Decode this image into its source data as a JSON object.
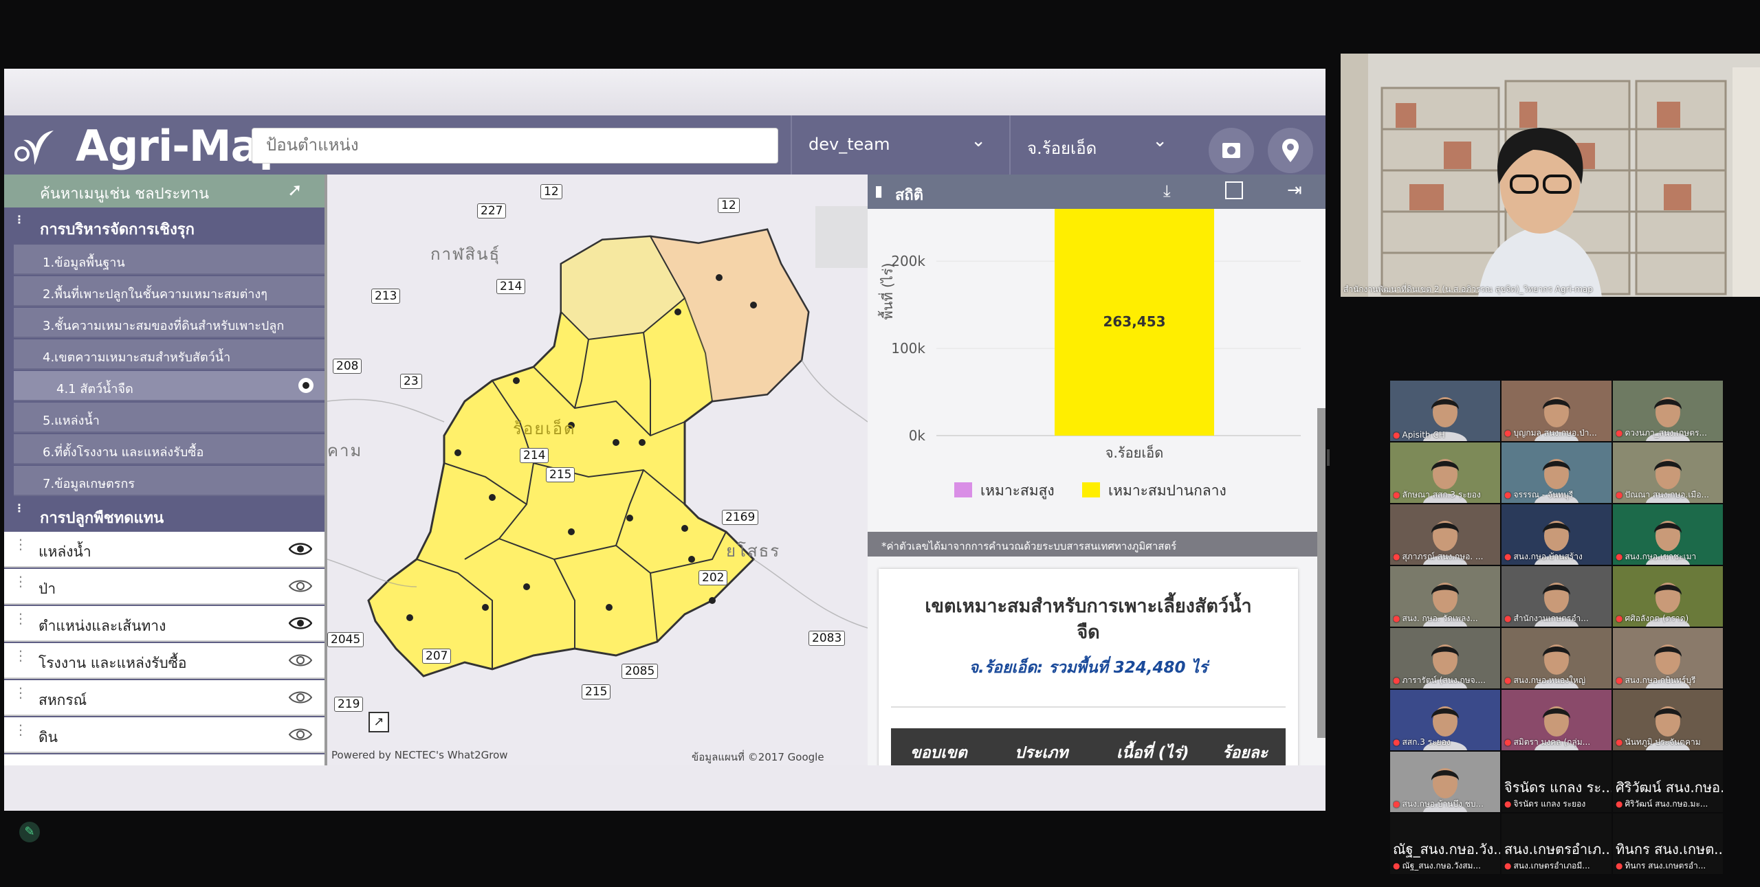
{
  "app": {
    "brand": "Agri-Map",
    "search_placeholder": "ป้อนตำแหน่ง",
    "team_select": "dev_team",
    "province_select": "จ.ร้อยเอ็ด"
  },
  "sidebar": {
    "menu_search_placeholder": "ค้นหาเมนูเช่น ชลประทาน",
    "section1_title": "การบริหารจัดการเชิงรุก",
    "items": [
      {
        "label": "1.ข้อมูลพื้นฐาน"
      },
      {
        "label": "2.พื้นที่เพาะปลูกในชั้นความเหมาะสมต่างๆ"
      },
      {
        "label": "3.ชั้นความเหมาะสมของที่ดินสำหรับเพาะปลูก"
      },
      {
        "label": "4.เขตความเหมาะสมสำหรับสัตว์น้ำ"
      },
      {
        "label": "4.1 สัตว์น้ำจืด"
      },
      {
        "label": "5.แหล่งน้ำ"
      },
      {
        "label": "6.ที่ตั้งโรงงาน และแหล่งรับซื้อ"
      },
      {
        "label": "7.ข้อมูลเกษตรกร"
      }
    ],
    "section2_title": "การปลูกพืชทดแทน",
    "layers": [
      {
        "label": "แหล่งน้ำ"
      },
      {
        "label": "ป่า"
      },
      {
        "label": "ตำแหน่งและเส้นทาง"
      },
      {
        "label": "โรงงาน และแหล่งรับซื้อ"
      },
      {
        "label": "สหกรณ์"
      },
      {
        "label": "ดิน"
      }
    ]
  },
  "map": {
    "places": [
      "กาฬสินธุ์",
      "ร้อยเอ็ด",
      "ยโสธร",
      "คาม"
    ],
    "roads": [
      "12",
      "227",
      "12",
      "213",
      "214",
      "208",
      "23",
      "214",
      "215",
      "2169",
      "202",
      "2045",
      "207",
      "2085",
      "219",
      "215",
      "2083"
    ],
    "attribution_left": "Powered by NECTEC's What2Grow",
    "attribution_right": "ข้อมูลแผนที่ ©2017 Google"
  },
  "stats": {
    "title": "สถิติ",
    "note": "*ค่าตัวเลขได้มาจากการคำนวณด้วยระบบสารสนเทศทางภูมิศาสตร์",
    "card_title_line1": "เขตเหมาะสมสำหรับการเพาะเลี้ยงสัตว์น้ำ",
    "card_title_line2": "จืด",
    "card_subtitle": "จ.ร้อยเอ็ด: รวมพื้นที่ 324,480 ไร่",
    "table_headers": [
      "ขอบเขต",
      "ประเภท",
      "เนื้อที่ (ไร่)",
      "ร้อยละ"
    ]
  },
  "chart_data": {
    "type": "bar",
    "categories": [
      "จ.ร้อยเอ็ด"
    ],
    "series": [
      {
        "name": "เหมาะสมสูง",
        "values": [
          0
        ],
        "color": "#d98ee6"
      },
      {
        "name": "เหมาะสมปานกลาง",
        "values": [
          263453
        ],
        "color": "#ffee00"
      }
    ],
    "data_labels": [
      "263,453"
    ],
    "ylabel": "พื้นที่ (ไร่)",
    "yticks": [
      "0k",
      "100k",
      "200k"
    ],
    "ylim": [
      0,
      260000
    ],
    "legend": "bottom"
  },
  "meeting": {
    "speaker_name": "สำนักงานพัฒนาที่ดินเขต 2 (น.ส.อภิวรรณ สุขจิต)_วิทยากร Agri-map",
    "participants": [
      {
        "name": "Apisith CH"
      },
      {
        "name": "บุญกมล สนง.กษอ.ป่า..."
      },
      {
        "name": "ดวงนภา_สนง.เกษตร..."
      },
      {
        "name": "ลักษณา สสก.3 ระยอง"
      },
      {
        "name": "จรรรณ - จันทบุรี"
      },
      {
        "name": "ปัณณา สนง.กษอ.เมือ..."
      },
      {
        "name": "สุภาภรณ์ สนง.กษอ. ..."
      },
      {
        "name": "สนง.กษอ.บ้านสร้าง"
      },
      {
        "name": "สนง.กษอ.เขาชะเมา"
      },
      {
        "name": "สนง. กษอ. วัดเพลง..."
      },
      {
        "name": "สำนักงานเกษตรอำ..."
      },
      {
        "name": "ศศิอลังกต (ตราด)"
      },
      {
        "name": "ภารารัตน์ (สนง.กษจ...."
      },
      {
        "name": "สนง.กษอ.หนองใหญ่"
      },
      {
        "name": "สนง.กษอ.กบินทร์บุรี"
      },
      {
        "name": "สสก.3 ระยอง"
      },
      {
        "name": "สมิตรา มงคล (กลุ่ม..."
      },
      {
        "name": "นันทภูมิ ประจันตคาม"
      },
      {
        "name": "สนง.กษอ.บ้านบึง ชบ..."
      },
      {
        "name": "จิรนัดร แกลง ระยอง",
        "display": "จิรนัดร แกลง ระ..."
      },
      {
        "name": "ศิริวัฒน์ สนง.กษอ.มะ...",
        "display": "ศิริวัฒน์ สนง.กษอ..."
      },
      {
        "name": "ณัฐ_สนง.กษอ.วังสม...",
        "display": "ณัฐ_สนง.กษอ.วัง..."
      },
      {
        "name": "สนง.เกษตรอำเภอมี...",
        "display": "สนง.เกษตรอำเภ..."
      },
      {
        "name": "ทินกร สนง.เกษตรอำ...",
        "display": "ทินกร สนง.เกษต..."
      }
    ]
  }
}
